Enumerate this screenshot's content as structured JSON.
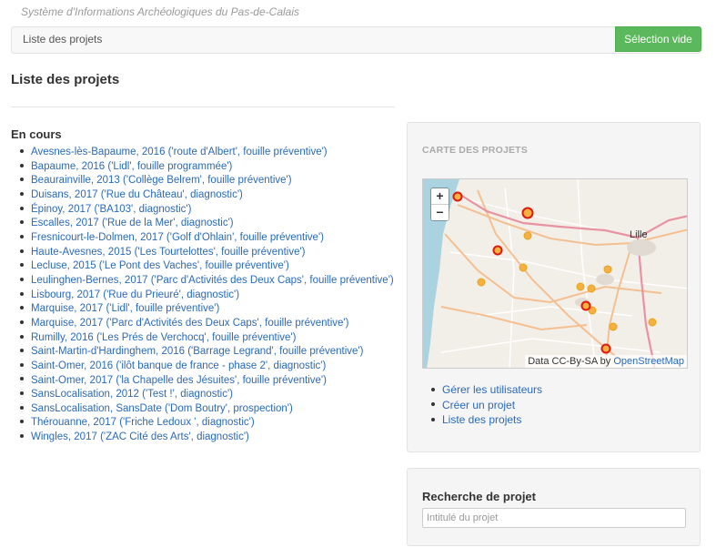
{
  "header": {
    "brand": "Système d'Informations Archéologiques du Pas-de-Calais",
    "breadcrumb": "Liste des projets",
    "empty_selection_button": "Sélection vide"
  },
  "main": {
    "title": "Liste des projets",
    "section_title": "En cours",
    "projects": [
      "Avesnes-lès-Bapaume, 2016 ('route d'Albert', fouille préventive')",
      "Bapaume, 2016 ('Lidl', fouille programmée')",
      "Beaurainville, 2013 ('Collège Belrem', fouille préventive')",
      "Duisans, 2017 ('Rue du Château', diagnostic')",
      "Épinoy, 2017 ('BA103', diagnostic')",
      "Escalles, 2017 ('Rue de la Mer', diagnostic')",
      "Fresnicourt-le-Dolmen, 2017 ('Golf d'Ohlain', fouille préventive')",
      "Haute-Avesnes, 2015 ('Les Tourtelottes', fouille préventive')",
      "Lecluse, 2015 ('Le Pont des Vaches', fouille préventive')",
      "Leulinghen-Bernes, 2017 ('Parc d'Activités des Deux Caps', fouille préventive')",
      "Lisbourg, 2017 ('Rue du Prieuré', diagnostic')",
      "Marquise, 2017 ('Lidl', fouille préventive')",
      "Marquise, 2017 ('Parc d'Activités des Deux Caps', fouille préventive')",
      "Rumilly, 2016 ('Les Prés de Verchocq', fouille préventive')",
      "Saint-Martin-d'Hardinghem, 2016 ('Barrage Legrand', fouille préventive')",
      "Saint-Omer, 2016 ('ilôt banque de france - phase 2', diagnostic')",
      "Saint-Omer, 2017 ('la Chapelle des Jésuites', fouille préventive')",
      "SansLocalisation, 2012 ('Test !', diagnostic')",
      "SansLocalisation, SansDate ('Dom Boutry', prospection')",
      "Thérouanne, 2017 ('Friche Ledoux ', diagnostic')",
      "Wingles, 2017 ('ZAC Cité des Arts', diagnostic')"
    ]
  },
  "map_panel": {
    "title": "CARTE DES PROJETS",
    "zoom_in": "+",
    "zoom_out": "−",
    "city_label": "Lille",
    "attribution_prefix": "Data CC-By-SA by ",
    "attribution_link": "OpenStreetMap",
    "links": [
      "Gérer les utilisateurs",
      "Créer un projet",
      "Liste des projets"
    ]
  },
  "search_panel": {
    "title": "Recherche de projet",
    "placeholder": "Intitulé du projet",
    "value": ""
  },
  "colors": {
    "link": "#2a6ab7",
    "success": "#5cb85c",
    "marker_fill": "#f5b041",
    "marker_stroke_selected": "#e0190d"
  }
}
